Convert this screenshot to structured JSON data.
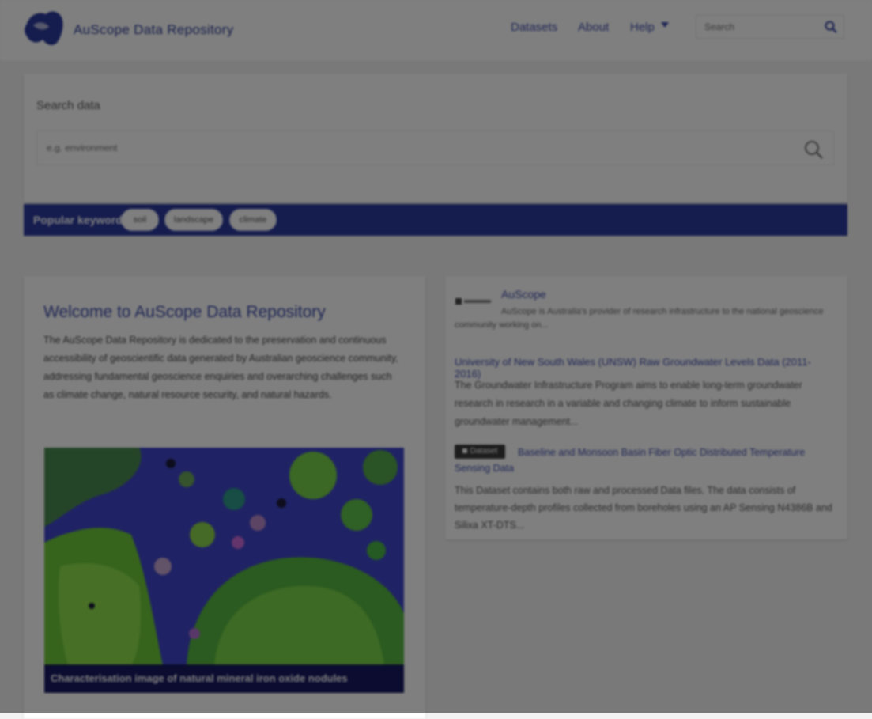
{
  "header": {
    "site_title": "AuScope Data Repository",
    "nav": {
      "datasets": "Datasets",
      "about": "About",
      "help": "Help"
    },
    "search_placeholder": "Search"
  },
  "search_panel": {
    "heading": "Search data",
    "placeholder": "e.g. environment"
  },
  "keywords": {
    "label": "Popular keywords:",
    "chips": [
      "soil",
      "landscape",
      "climate"
    ]
  },
  "welcome": {
    "title": "Welcome to AuScope Data Repository",
    "text": "The AuScope Data Repository is dedicated to the preservation and continuous accessibility of geoscientific data generated by Australian geoscience community, addressing fundamental geoscience enquiries and overarching challenges such as climate change, natural resource security, and natural hazards.",
    "figure_caption": "Characterisation image of natural mineral iron oxide nodules"
  },
  "featured": {
    "org_logo_text": "AuScope",
    "org_name": "AuScope",
    "org_desc": "AuScope is Australia's provider of research infrastructure to the national geoscience community working on...",
    "dataset1_title": "University of New South Wales (UNSW) Raw Groundwater Levels Data (2011-2016)",
    "dataset1_desc": "The Groundwater Infrastructure Program aims to enable long-term groundwater research in research in a variable and changing climate to inform sustainable groundwater management...",
    "badge_label": "Dataset",
    "dataset2_title": "Baseline and Monsoon Basin Fiber Optic Distributed Temperature Sensing Data",
    "dataset2_desc": "This Dataset contains both raw and processed Data files. The data consists of temperature-depth profiles collected from boreholes using an AP Sensing N4386B and Silixa XT-DTS..."
  },
  "colors": {
    "brand": "#2b3a9c",
    "link": "#3b4aa8",
    "overlay": "rgba(0,0,0,0.5)"
  }
}
